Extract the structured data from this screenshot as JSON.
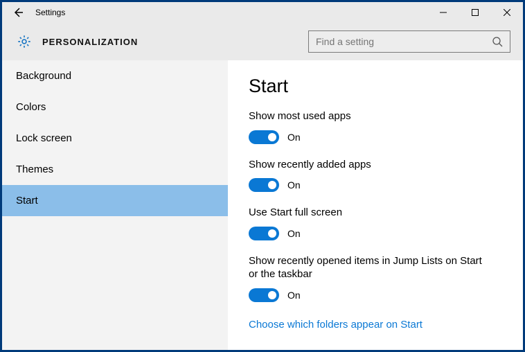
{
  "window": {
    "title": "Settings"
  },
  "header": {
    "section": "PERSONALIZATION",
    "search_placeholder": "Find a setting"
  },
  "sidebar": {
    "items": [
      {
        "label": "Background",
        "selected": false
      },
      {
        "label": "Colors",
        "selected": false
      },
      {
        "label": "Lock screen",
        "selected": false
      },
      {
        "label": "Themes",
        "selected": false
      },
      {
        "label": "Start",
        "selected": true
      }
    ]
  },
  "content": {
    "page_title": "Start",
    "settings": [
      {
        "label": "Show most used apps",
        "state": "On",
        "on": true
      },
      {
        "label": "Show recently added apps",
        "state": "On",
        "on": true
      },
      {
        "label": "Use Start full screen",
        "state": "On",
        "on": true
      },
      {
        "label": "Show recently opened items in Jump Lists on Start or the taskbar",
        "state": "On",
        "on": true
      }
    ],
    "link": "Choose which folders appear on Start"
  },
  "colors": {
    "accent": "#0a78d4",
    "sidebar_selected": "#8bbee9"
  }
}
